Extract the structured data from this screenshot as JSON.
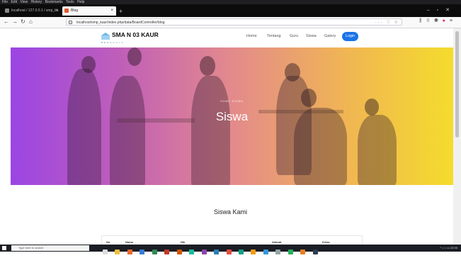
{
  "browser": {
    "menu": [
      "File",
      "Edit",
      "View",
      "History",
      "Bookmarks",
      "Tools",
      "Help"
    ],
    "tabs": [
      {
        "label": "localhost / 127.0.0.1 / smp_ku"
      },
      {
        "label": "Blog"
      }
    ],
    "url": "localhost/smp_kaur/index.php/data/BoardController/blog"
  },
  "site": {
    "brand": "SMA N 03 KAUR",
    "brand_sub": "BENGKULU",
    "nav": [
      "Home",
      "Tentang",
      "Guru",
      "Siswa",
      "Galery"
    ],
    "login_label": "Login"
  },
  "hero": {
    "breadcrumb": "HOME   SISWA",
    "title": "Siswa",
    "gradient": [
      "#9b45e4",
      "#f4dc2c"
    ]
  },
  "section": {
    "title": "Siswa Kami",
    "table_headers": [
      "No",
      "Nama",
      "Nik",
      "Alamat",
      "Kelas"
    ]
  },
  "taskbar": {
    "search_placeholder": "Type here to search",
    "time": "22:00"
  },
  "colors": {
    "accent": "#1a73e8"
  }
}
